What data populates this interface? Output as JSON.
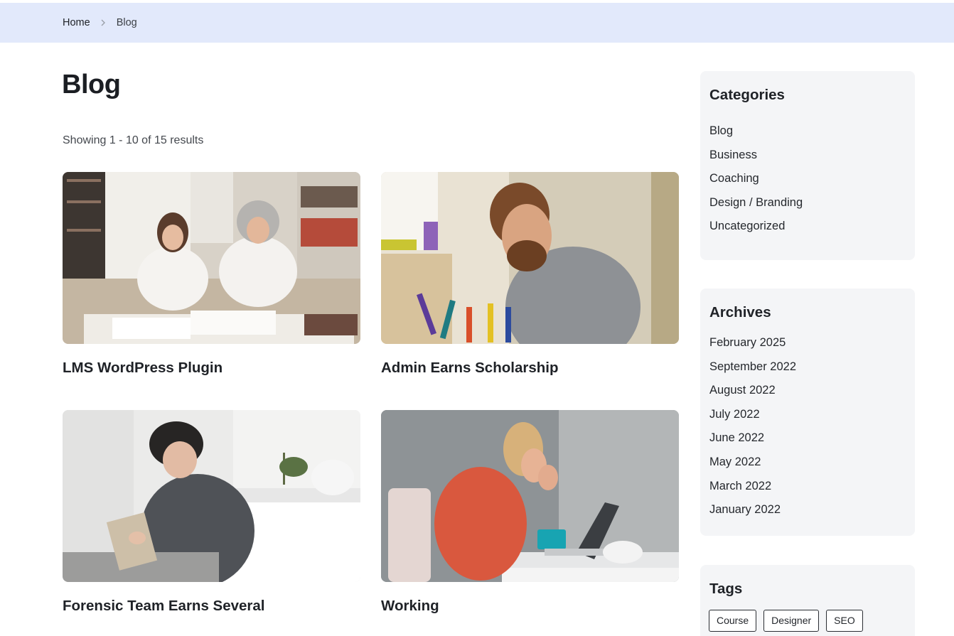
{
  "breadcrumb": {
    "home_label": "Home",
    "current_label": "Blog"
  },
  "page_title": "Blog",
  "results_text": "Showing 1 - 10 of 15 results",
  "posts": [
    {
      "title": "LMS WordPress Plugin"
    },
    {
      "title": "Admin Earns Scholarship"
    },
    {
      "title": "Forensic Team Earns Several"
    },
    {
      "title": "Working"
    }
  ],
  "sidebar": {
    "categories": {
      "title": "Categories",
      "items": [
        "Blog",
        "Business",
        "Coaching",
        "Design / Branding",
        "Uncategorized"
      ]
    },
    "archives": {
      "title": "Archives",
      "items": [
        "February 2025",
        "September 2022",
        "August 2022",
        "July 2022",
        "June 2022",
        "May 2022",
        "March 2022",
        "January 2022"
      ]
    },
    "tags": {
      "title": "Tags",
      "items": [
        "Course",
        "Designer",
        "SEO"
      ]
    }
  },
  "colors": {
    "breadcrumb_bg": "#e2e9fb",
    "widget_bg": "#f4f5f7",
    "text": "#1e2126"
  }
}
